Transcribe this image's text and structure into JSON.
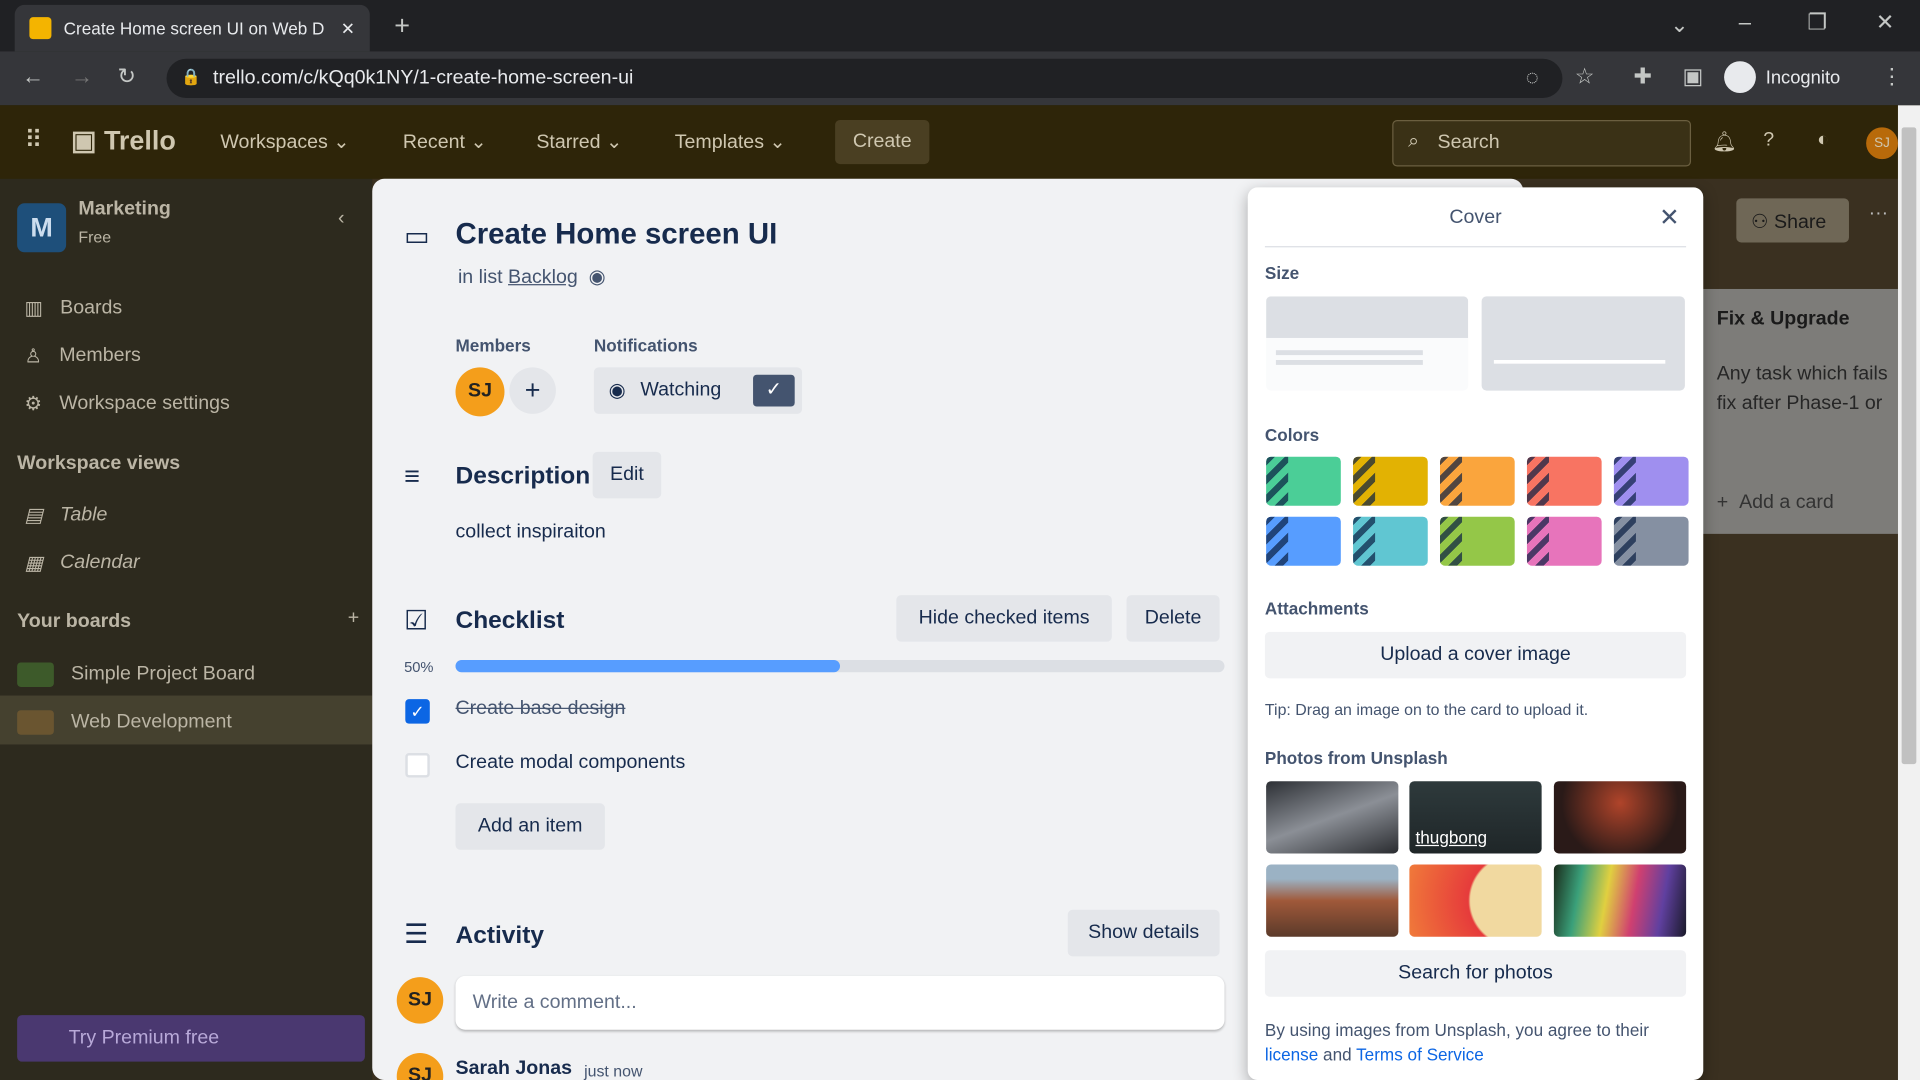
{
  "browser": {
    "tab_title": "Create Home screen UI on Web D",
    "url": "trello.com/c/kQq0k1NY/1-create-home-screen-ui",
    "profile": "Incognito"
  },
  "header": {
    "logo": "Trello",
    "nav": [
      "Workspaces",
      "Recent",
      "Starred",
      "Templates"
    ],
    "create": "Create",
    "search_placeholder": "Search",
    "avatar": "SJ"
  },
  "sidebar": {
    "workspace_initial": "M",
    "workspace": "Marketing",
    "plan": "Free",
    "items": [
      "Boards",
      "Members",
      "Workspace settings"
    ],
    "views_title": "Workspace views",
    "views": [
      "Table",
      "Calendar"
    ],
    "boards_title": "Your boards",
    "boards": [
      "Simple Project Board",
      "Web Development"
    ],
    "premium": "Try Premium free"
  },
  "board": {
    "share": "Share",
    "list_title": "Fix & Upgrade",
    "card_text": "Any task which fails fix after Phase-1 or",
    "add_card": "Add a card"
  },
  "card": {
    "title": "Create Home screen UI",
    "in_list_prefix": "in list",
    "list_name": "Backlog",
    "members_label": "Members",
    "member_initials": "SJ",
    "notifications_label": "Notifications",
    "watching": "Watching",
    "description_title": "Description",
    "edit": "Edit",
    "description": "collect inspiraiton",
    "checklist_title": "Checklist",
    "hide_checked": "Hide checked items",
    "delete": "Delete",
    "progress_percent": 50,
    "progress_label": "50%",
    "items": [
      {
        "text": "Create base design",
        "checked": true
      },
      {
        "text": "Create modal components",
        "checked": false
      }
    ],
    "add_item": "Add an item",
    "activity_title": "Activity",
    "show_details": "Show details",
    "comment_placeholder": "Write a comment...",
    "activity_user": "Sarah Jonas",
    "activity_time": "just now"
  },
  "cover": {
    "title": "Cover",
    "size_label": "Size",
    "colors_label": "Colors",
    "colors": [
      "#4bce97",
      "#e2b203",
      "#faa53d",
      "#f87462",
      "#9f8fef",
      "#579dff",
      "#60c6d2",
      "#94c748",
      "#e774bb",
      "#8590a2"
    ],
    "attachments_label": "Attachments",
    "upload": "Upload a cover image",
    "tip": "Tip: Drag an image on to the card to upload it.",
    "photos_label": "Photos from Unsplash",
    "photo_hover_author": "thugbong",
    "search_photos": "Search for photos",
    "legal_prefix": "By using images from Unsplash, you agree to their",
    "license": "license",
    "and": "and",
    "terms": "Terms of Service"
  }
}
